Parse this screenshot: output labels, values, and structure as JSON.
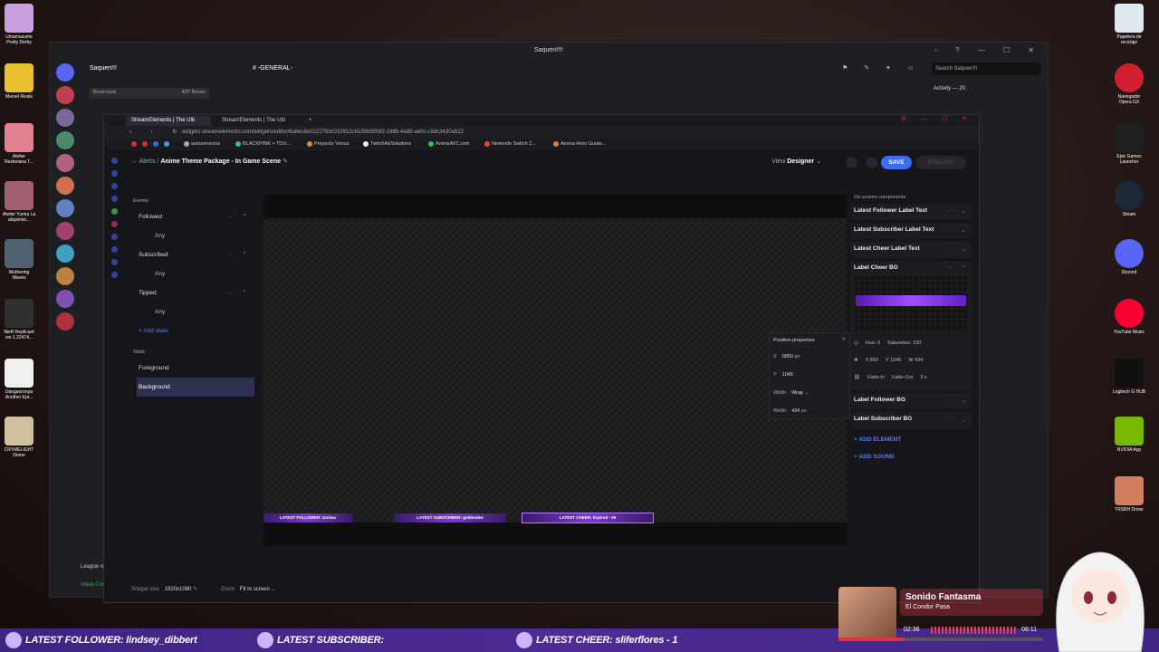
{
  "desktop_left": [
    {
      "label": "Umamusume Pretty Derby",
      "color": "#c8a0e0"
    },
    {
      "label": "Marvel Rivals",
      "color": "#e8c030"
    },
    {
      "label": "Atelier Resleriana T...",
      "color": "#e08090"
    },
    {
      "label": "Atelier Yumia La alquimist...",
      "color": "#a06070"
    },
    {
      "label": "Wuthering Waves",
      "color": "#506070"
    },
    {
      "label": "NieR Replicant ver.1.22474...",
      "color": "#303030"
    },
    {
      "label": "Danganronpa Another Epi...",
      "color": "#f0f0f0"
    },
    {
      "label": "CRYMELIGHT Demo",
      "color": "#d0c0a0"
    }
  ],
  "desktop_right": [
    {
      "label": "Papelera de reciclaje",
      "color": "#e0e8f0"
    },
    {
      "label": "Navegador Opera GX",
      "color": "#d02030"
    },
    {
      "label": "Epic Games Launcher",
      "color": "#202020"
    },
    {
      "label": "Steam",
      "color": "#1b2838"
    },
    {
      "label": "Discord",
      "color": "#5865f2"
    },
    {
      "label": "YouTube Music",
      "color": "#ff0033"
    },
    {
      "label": "Logitech G HUB",
      "color": "#101010"
    },
    {
      "label": "NVIDIA App",
      "color": "#76b900"
    },
    {
      "label": "TRSBH Driver",
      "color": "#d08060"
    }
  ],
  "discord": {
    "window_title": "Saquen!!!!",
    "server_name": "Saquen!!!",
    "channel": "-GENERAL-",
    "boost_goal": "Boost Goal",
    "boosts": "4/37 Boosts",
    "search_placeholder": "Search Saquen!!!",
    "activity": "Activity — 20",
    "voice_channel": "League of",
    "voice_connected": "Voice Con"
  },
  "browser": {
    "tab1": "StreamElements | The Ulti",
    "tab2": "StreamElements | The Ulti",
    "url": "widgets.streamelements.com/widgets/editor/6a6ec8e0122793c010912c61/58d35bf2-188b-4a85-ae0c-c9dc3430a512",
    "bookmarks": [
      "autoservicios",
      "BLACKPINK > TOU...",
      "Proyecto Venus",
      "TwitchAdSolutions",
      "AnimeAV1.com",
      "Nintendo Switch 2...",
      "Aeona Hero Guide..."
    ]
  },
  "editor": {
    "breadcrumb_root": "Alerts",
    "breadcrumb_sep": "/",
    "title": "Anime Theme Package - In Game Scene",
    "view_label": "View",
    "view_value": "Designer",
    "save": "SAVE",
    "publish": "PUBLISH",
    "events_header": "Events",
    "events": [
      {
        "name": "Followed",
        "state": "Any"
      },
      {
        "name": "Subscribed",
        "state": "Any"
      },
      {
        "name": "Tipped",
        "state": "Any"
      }
    ],
    "add_state": "Add state",
    "static_header": "Static",
    "foreground": "Foreground",
    "background": "Background",
    "canvas_labels": {
      "follower": "LATEST FOLLOWER: zovitax",
      "subscriber": "LATEST SUBSCRIBER: goldendee",
      "cheer": "LATEST CHEER: Expired - 95"
    },
    "position_panel": {
      "title": "Position properties",
      "x_label": "X",
      "x_value": "0850",
      "x_unit": "px",
      "y_label": "Y",
      "y_value": "1045",
      "width_label": "Width",
      "width_mode": "Wrap",
      "width2_label": "Width",
      "width_value": "434",
      "width_unit": "px"
    },
    "components_header": "On-screen components",
    "components": [
      "Latest Follower Label Text",
      "Latest Subscriber Label Text",
      "Latest Cheer Label Text",
      "Label Cheer BG",
      "Label Follower BG",
      "Label Subscriber BG"
    ],
    "cheer_bg_props": {
      "hue": "Hue: 0",
      "saturation": "Saturation: 100",
      "x": "X 850",
      "y": "Y 1045",
      "w": "W 434",
      "fade_in": "Fade-In",
      "fade_out": "Fade-Out",
      "fade_time": "3 s"
    },
    "add_element": "ADD ELEMENT",
    "add_sound": "ADD SOUND",
    "widget_size_label": "Widget size",
    "widget_size": "1920x1080",
    "zoom_label": "Zoom",
    "zoom_value": "Fit to screen"
  },
  "ticker": {
    "follower": "LATEST FOLLOWER: lindsey_dibbert",
    "subscriber": "LATEST SUBSCRIBER:",
    "cheer": "LATEST CHEER: sliferflores - 1"
  },
  "music": {
    "song": "Sonido Fantasma",
    "artist": "El Condor Pasa",
    "elapsed": "02:36",
    "total": "08:11",
    "progress": 0.32
  }
}
